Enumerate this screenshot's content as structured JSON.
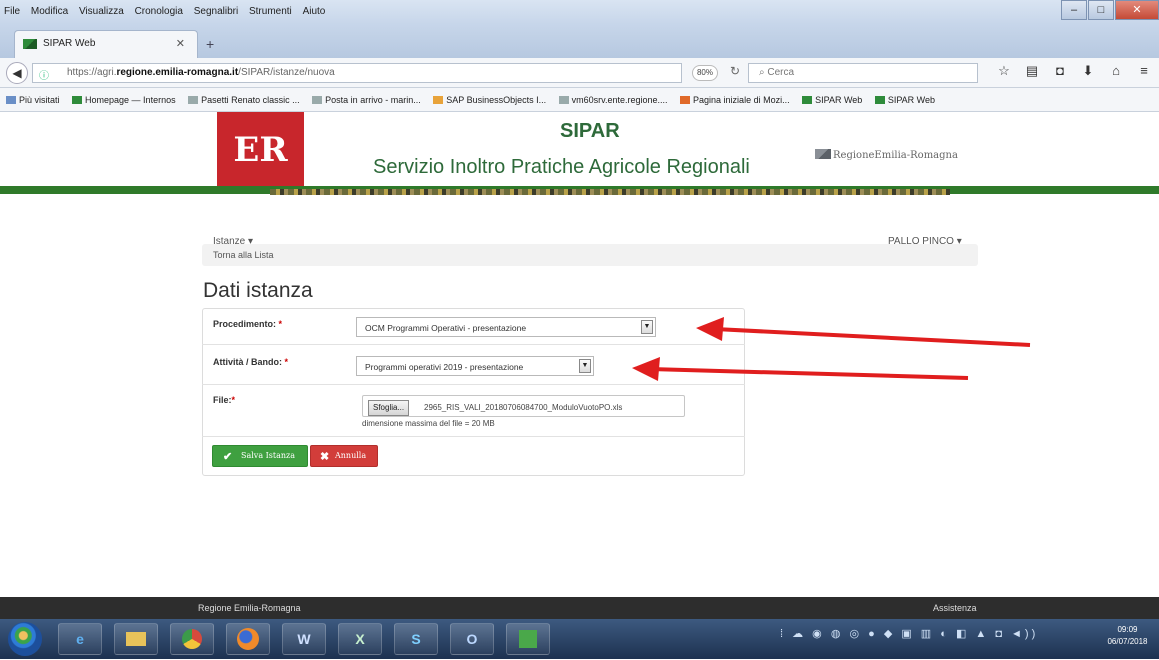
{
  "browser": {
    "menu": [
      "File",
      "Modifica",
      "Visualizza",
      "Cronologia",
      "Segnalibri",
      "Strumenti",
      "Aiuto"
    ],
    "tab_title": "SIPAR Web",
    "url_prefix": "https://agri.",
    "url_domain": "regione.emilia-romagna.it",
    "url_path": "/SIPAR/istanze/nuova",
    "zoom": "80%",
    "search_placeholder": "Cerca",
    "bookmarks": [
      "Più visitati",
      "Homepage — Internos",
      "Pasetti Renato classic ...",
      "Posta in arrivo - marin...",
      "SAP BusinessObjects I...",
      "vm60srv.ente.regione....",
      "Pagina iniziale di Mozi...",
      "SIPAR Web",
      "SIPAR Web"
    ]
  },
  "header": {
    "logo_text": "ER",
    "title": "SIPAR",
    "subtitle": "Servizio Inoltro Pratiche Agricole Regionali",
    "regione_logo_text": "RegioneEmilia-Romagna"
  },
  "nav": {
    "istanze": "Istanze",
    "user": "PALLO PINCO",
    "breadcrumb": "Torna alla Lista"
  },
  "form": {
    "page_title": "Dati istanza",
    "procedimento_label": "Procedimento:",
    "procedimento_value": "OCM Programmi Operativi - presentazione",
    "attivita_label": "Attività / Bando:",
    "attivita_value": "Programmi operativi 2019 - presentazione",
    "file_label": "File:",
    "required_mark": "*",
    "file_button": "Sfoglia...",
    "file_name": "2965_RIS_VALI_20180706084700_ModuloVuotoPO.xls",
    "file_hint": "dimensione massima del file = 20 MB",
    "save_label": "Salva Istanza",
    "cancel_label": "Annulla"
  },
  "footer": {
    "left": "Regione Emilia-Romagna",
    "right": "Assistenza"
  },
  "taskbar": {
    "apps": [
      "e",
      "",
      "",
      "",
      "W",
      "X",
      "S",
      "O",
      ""
    ],
    "time": "09:09",
    "date": "06/07/2018"
  },
  "colors": {
    "brand_red": "#c8262c",
    "brand_green": "#2e6a3a",
    "save_green": "#3fa040",
    "cancel_red": "#d23d3a",
    "arrow_red": "#e01e1e"
  }
}
